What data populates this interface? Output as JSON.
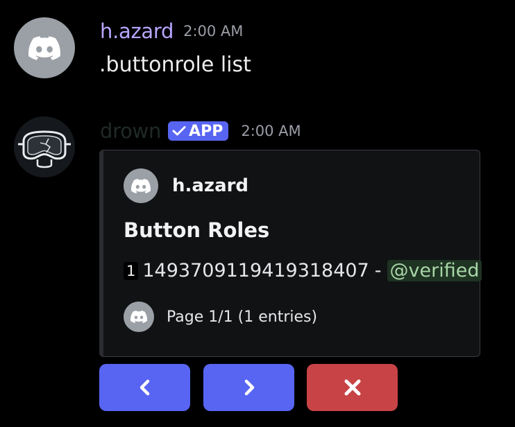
{
  "messages": [
    {
      "author": "h.azard",
      "author_color": "#b9a6ff",
      "timestamp": "2:00 AM",
      "content": ".buttonrole list",
      "avatar_icon": "discord-logo-icon"
    },
    {
      "author": "drown",
      "author_color": "#1f2a26",
      "badge": "APP",
      "badge_icon": "checkmark-icon",
      "timestamp": "2:00 AM",
      "avatar_icon": "goggles-mask-icon",
      "embed": {
        "author_name": "h.azard",
        "author_icon": "discord-logo-icon",
        "title": "Button Roles",
        "description": {
          "index": "1",
          "role_id": "1493709119419318407",
          "separator": "-",
          "mention": "@verified"
        },
        "footer_text": "Page 1/1 (1 entries)",
        "footer_icon": "discord-logo-icon"
      },
      "buttons": [
        {
          "icon": "chevron-left-icon",
          "style": "primary",
          "color": "#5865f2"
        },
        {
          "icon": "chevron-right-icon",
          "style": "primary",
          "color": "#5865f2"
        },
        {
          "icon": "close-icon",
          "style": "danger",
          "color": "#c84346"
        }
      ]
    }
  ]
}
